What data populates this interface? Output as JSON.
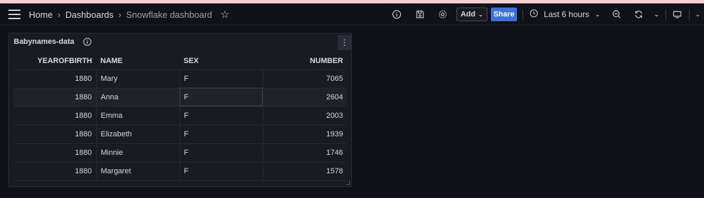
{
  "header": {
    "breadcrumb": [
      "Home",
      "Dashboards",
      "Snowflake dashboard"
    ],
    "add_label": "Add",
    "share_label": "Share",
    "time_range": "Last 6 hours"
  },
  "panel": {
    "title": "Babynames-data",
    "columns": [
      "YEAROFBIRTH",
      "NAME",
      "SEX",
      "NUMBER"
    ],
    "rows": [
      [
        "1880",
        "Mary",
        "F",
        "7065"
      ],
      [
        "1880",
        "Anna",
        "F",
        "2604"
      ],
      [
        "1880",
        "Emma",
        "F",
        "2003"
      ],
      [
        "1880",
        "Elizabeth",
        "F",
        "1939"
      ],
      [
        "1880",
        "Minnie",
        "F",
        "1746"
      ],
      [
        "1880",
        "Margaret",
        "F",
        "1578"
      ]
    ]
  },
  "colors": {
    "accent_strip": "#f4cfd2",
    "share": "#3d71d9",
    "background": "#111217",
    "panel": "#181b1f"
  }
}
